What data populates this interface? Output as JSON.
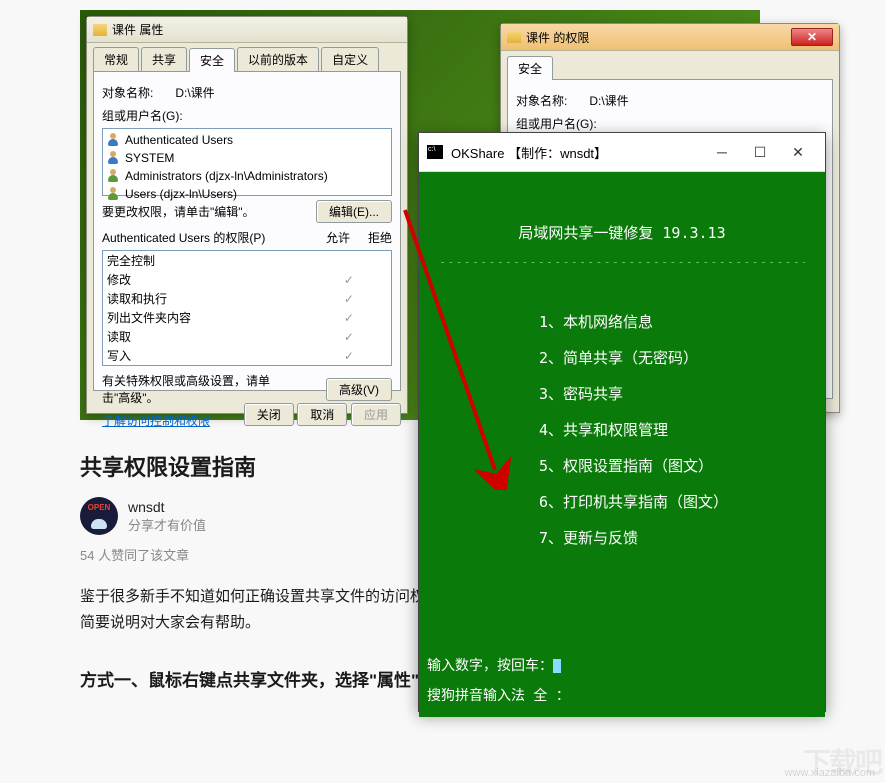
{
  "props_window": {
    "title": "课件 属性",
    "tabs": [
      "常规",
      "共享",
      "安全",
      "以前的版本",
      "自定义"
    ],
    "active_tab": "安全",
    "object_label": "对象名称:",
    "object_value": "D:\\课件",
    "groups_label": "组或用户名(G):",
    "users": [
      "Authenticated Users",
      "SYSTEM",
      "Administrators (djzx-ln\\Administrators)",
      "Users (djzx-ln\\Users)"
    ],
    "edit_hint": "要更改权限，请单击\"编辑\"。",
    "edit_btn": "编辑(E)...",
    "perm_header": "Authenticated Users 的权限(P)",
    "allow": "允许",
    "deny": "拒绝",
    "permissions": [
      "完全控制",
      "修改",
      "读取和执行",
      "列出文件夹内容",
      "读取",
      "写入"
    ],
    "advanced_hint": "有关特殊权限或高级设置，请单击\"高级\"。",
    "advanced_btn": "高级(V)",
    "help_link": "了解访问控制和权限",
    "close_btn": "关闭",
    "cancel_btn": "取消",
    "apply_btn": "应用"
  },
  "perm_window": {
    "title": "课件 的权限",
    "tab": "安全",
    "object_label": "对象名称:",
    "object_value": "D:\\课件",
    "groups_label": "组或用户名(G):"
  },
  "okshare": {
    "title": "OKShare  【制作：wnsdt】",
    "header": "局域网共享一键修复  19.3.13",
    "menu": [
      "1、本机网络信息",
      "2、简单共享（无密码）",
      "3、密码共享",
      "4、共享和权限管理",
      "5、权限设置指南（图文）",
      "6、打印机共享指南（图文）",
      "7、更新与反馈"
    ],
    "prompt": "输入数字，按回车：",
    "ime": "搜狗拼音输入法  全 ："
  },
  "article": {
    "title": "共享权限设置指南",
    "author": "wnsdt",
    "author_tag": "分享才有价值",
    "likes": "54 人赞同了该文章",
    "body": "鉴于很多新手不知道如何正确设置共享文件的访问权限，本篇介绍种不同的设置步骤（推荐后者），并简要说明对大家会有帮助。",
    "heading": "方式一、鼠标右键点共享文件夹，选择\"属性\""
  },
  "watermark": {
    "text": "下载吧",
    "url": "www.xiazaiba.com"
  }
}
